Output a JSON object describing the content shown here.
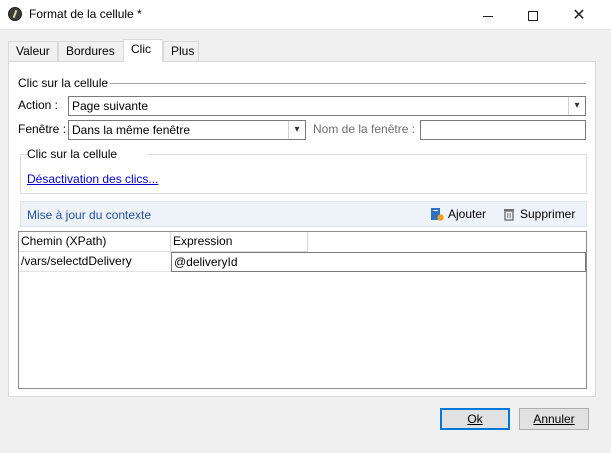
{
  "window": {
    "title": "Format de la cellule *",
    "icons": {
      "app": "app-icon",
      "minimize": "minimize-icon",
      "maximize": "maximize-icon",
      "close": "close-icon"
    }
  },
  "tabs": [
    {
      "label": "Valeur",
      "active": false
    },
    {
      "label": "Bordures",
      "active": false
    },
    {
      "label": "Clic",
      "active": true
    },
    {
      "label": "Plus",
      "active": false
    }
  ],
  "click_group": {
    "heading": "Clic sur la cellule",
    "action_label": "Action :",
    "action_value": "Page suivante",
    "window_label": "Fenêtre :",
    "window_value": "Dans la même fenêtre",
    "window_name_label": "Nom de la fenêtre :",
    "window_name_value": ""
  },
  "inner_group": {
    "heading": "Clic sur la cellule",
    "link": "Désactivation des clics..."
  },
  "context": {
    "title": "Mise à jour du contexte",
    "add_label": "Ajouter",
    "delete_label": "Supprimer",
    "columns": [
      "Chemin (XPath)",
      "Expression"
    ],
    "rows": [
      {
        "path": "/vars/selectdDelivery",
        "expression": "@deliveryId"
      }
    ]
  },
  "buttons": {
    "ok": "Ok",
    "cancel": "Annuler"
  },
  "colors": {
    "link": "#0000d0",
    "context_title": "#2050a0",
    "default_button_border": "#0078d7"
  }
}
